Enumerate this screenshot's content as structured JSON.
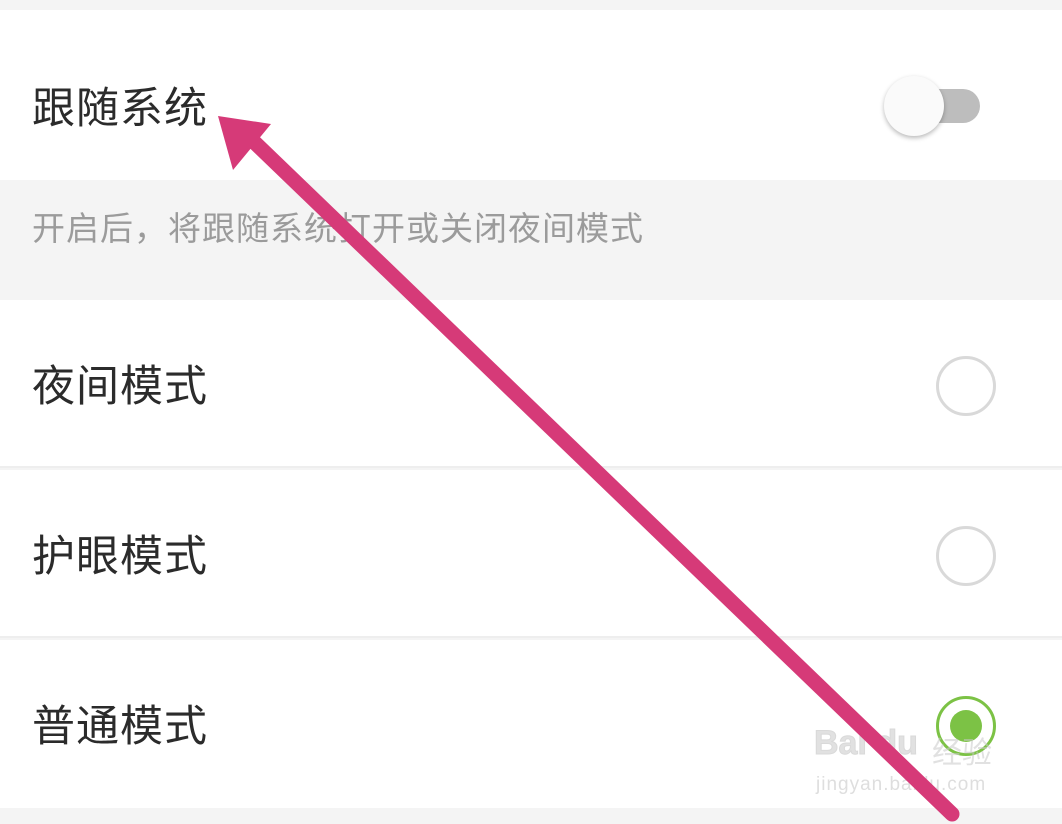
{
  "settings": {
    "follow_system": {
      "label": "跟随系统",
      "enabled": false
    },
    "follow_system_description": "开启后，将跟随系统打开或关闭夜间模式",
    "modes": [
      {
        "label": "夜间模式",
        "selected": false
      },
      {
        "label": "护眼模式",
        "selected": false
      },
      {
        "label": "普通模式",
        "selected": true
      }
    ]
  },
  "colors": {
    "accent": "#7cc245",
    "annotation_arrow": "#d63a78",
    "toggle_off_track": "#bdbdbd",
    "section_background": "#f4f4f4"
  },
  "watermark": {
    "brand": "Bai du",
    "name": "经验",
    "url": "jingyan.baidu.com"
  }
}
